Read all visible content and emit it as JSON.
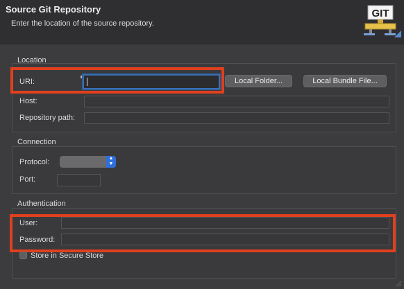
{
  "header": {
    "title": "Source Git Repository",
    "description": "Enter the location of the source repository.",
    "logo_text": "GIT"
  },
  "location": {
    "title": "Location",
    "uri_label": "URI:",
    "uri_value": "",
    "local_folder_button": "Local Folder...",
    "local_bundle_button": "Local Bundle File...",
    "host_label": "Host:",
    "host_value": "",
    "repo_path_label": "Repository path:",
    "repo_path_value": ""
  },
  "connection": {
    "title": "Connection",
    "protocol_label": "Protocol:",
    "protocol_value": "",
    "port_label": "Port:",
    "port_value": ""
  },
  "authentication": {
    "title": "Authentication",
    "user_label": "User:",
    "user_value": "",
    "password_label": "Password:",
    "password_value": "",
    "secure_store_label": "Store in Secure Store"
  },
  "colors": {
    "highlight": "#e0401e",
    "focus": "#3a6fb3",
    "select_arrow": "#2f6fdc"
  }
}
